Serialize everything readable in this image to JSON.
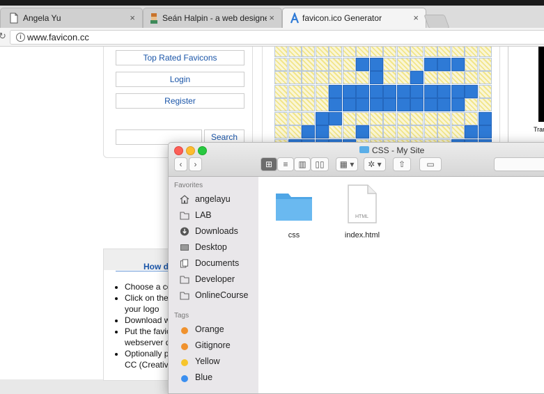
{
  "browser": {
    "tabs": [
      {
        "title": "Angela Yu",
        "active": false,
        "icon": "page-icon"
      },
      {
        "title": "Seán Halpin - a web designer &",
        "active": false,
        "icon": "favicon-man-icon"
      },
      {
        "title": "favicon.ico Generator",
        "active": true,
        "icon": "favicon-a-icon"
      }
    ],
    "url": "www.favicon.cc"
  },
  "page": {
    "nav": {
      "top_rated": "Top Rated Favicons",
      "login": "Login",
      "register": "Register",
      "search_button": "Search",
      "search_value": ""
    },
    "how": {
      "title": "How d",
      "items": [
        "Choose a co",
        "Click on the",
        "your logo",
        "Download w",
        "Put the favic",
        "webserver d",
        "Optionally p",
        "CC (Creativ"
      ]
    },
    "preview_text": "Trar"
  },
  "finder": {
    "title": "CSS - My Site",
    "sidebar": {
      "favorites_heading": "Favorites",
      "favorites": [
        {
          "label": "angelayu",
          "icon": "home-icon"
        },
        {
          "label": "LAB",
          "icon": "folder-icon"
        },
        {
          "label": "Downloads",
          "icon": "downloads-icon"
        },
        {
          "label": "Desktop",
          "icon": "desktop-icon"
        },
        {
          "label": "Documents",
          "icon": "documents-icon"
        },
        {
          "label": "Developer",
          "icon": "folder-icon"
        },
        {
          "label": "OnlineCourse",
          "icon": "folder-icon"
        }
      ],
      "tags_heading": "Tags",
      "tags": [
        {
          "label": "Orange",
          "color": "#f0922e"
        },
        {
          "label": "Gitignore",
          "color": "#f0922e"
        },
        {
          "label": "Yellow",
          "color": "#f7c52b"
        },
        {
          "label": "Blue",
          "color": "#3b8ff0"
        }
      ]
    },
    "files": [
      {
        "name": "css",
        "type": "folder"
      },
      {
        "name": "index.html",
        "type": "html",
        "badge": "HTML"
      }
    ]
  },
  "colors": {
    "accent": "#1a55a8",
    "pixel_on": "#2e7ad6",
    "folder": "#5aaee8"
  }
}
